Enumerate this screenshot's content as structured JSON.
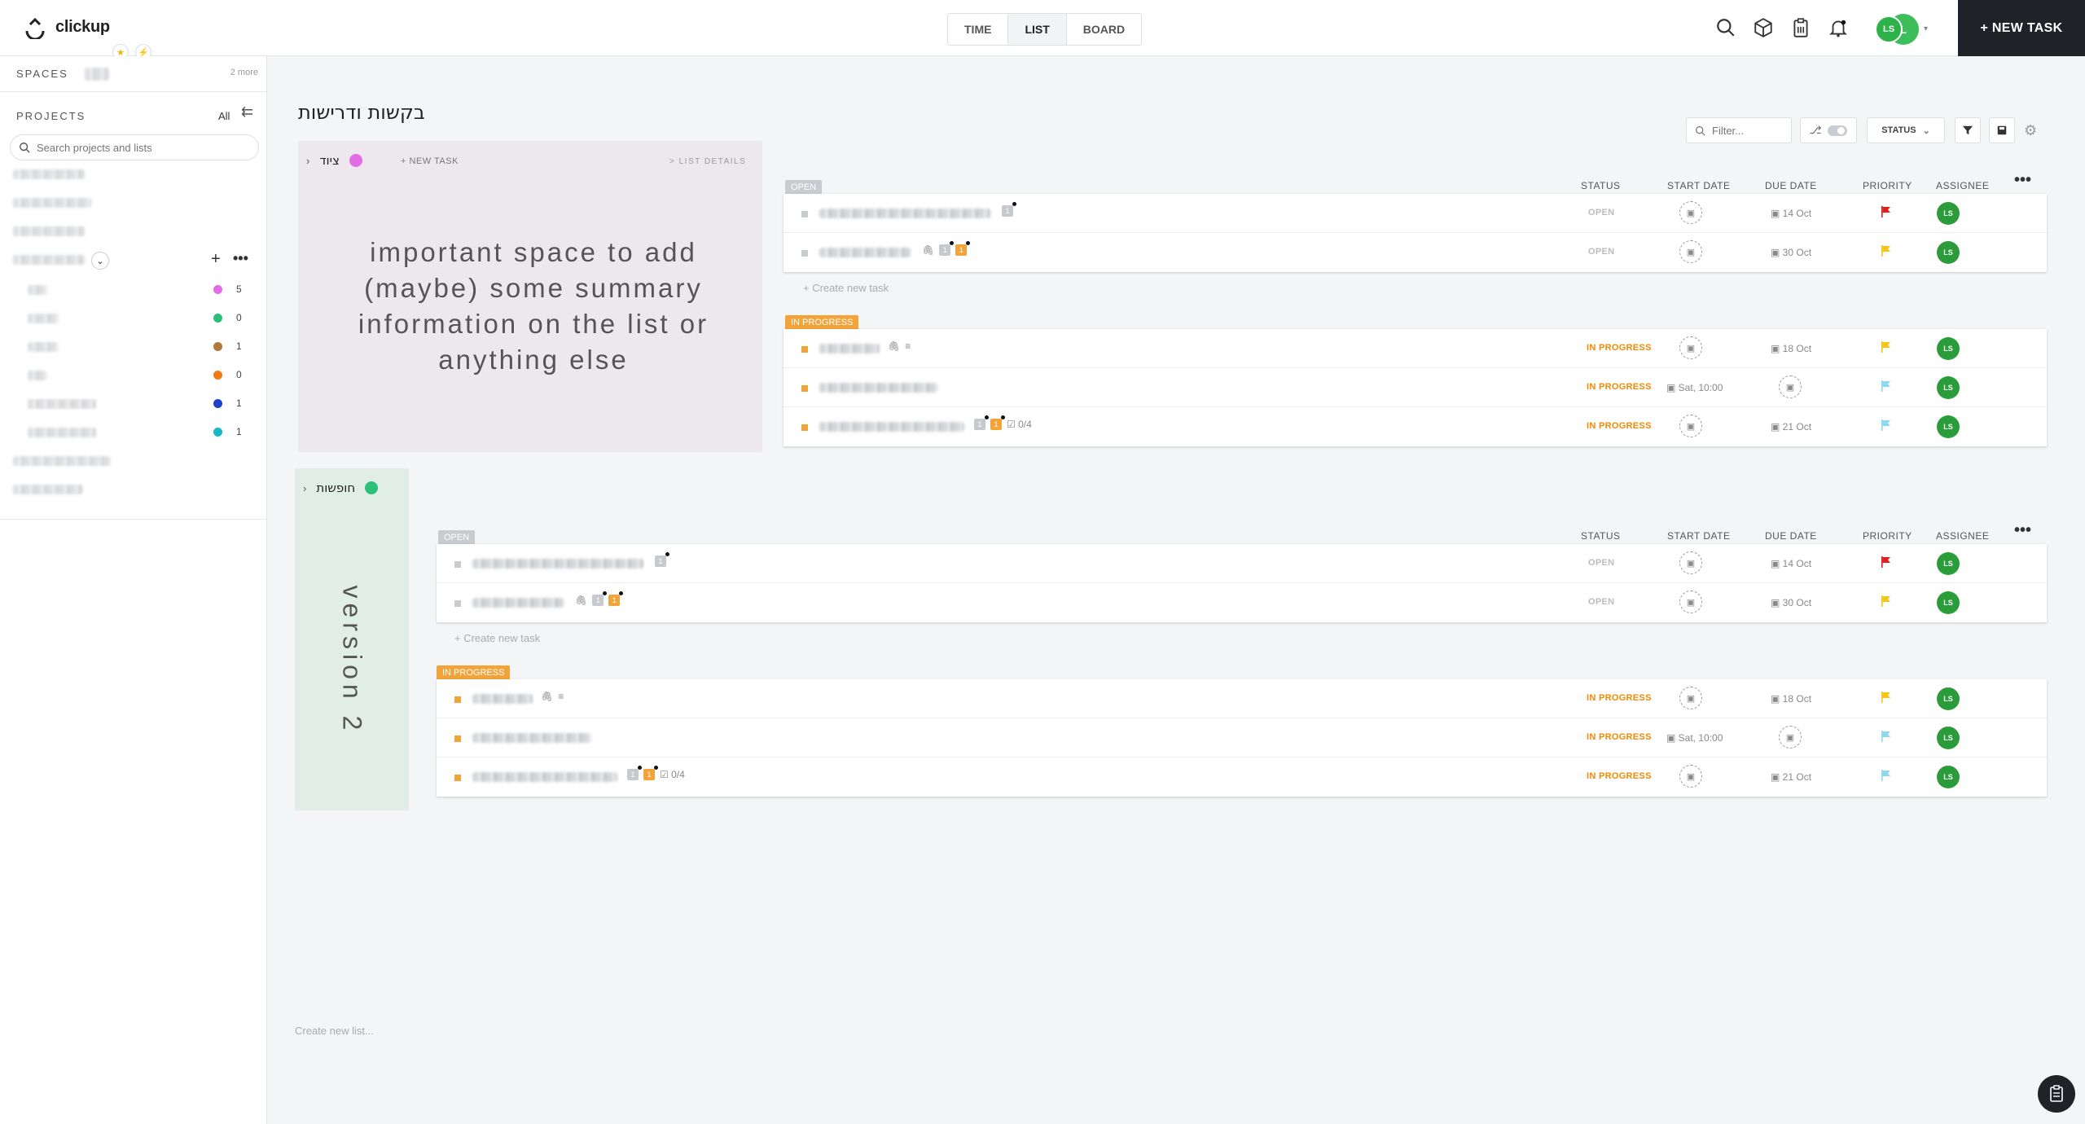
{
  "app": {
    "name": "clickup"
  },
  "header": {
    "views": [
      "TIME",
      "LIST",
      "BOARD"
    ],
    "active_view": "LIST",
    "avatar_initials": "LS",
    "avatar_initials_alt": "L",
    "new_task_label": "+ NEW TASK"
  },
  "sidebar": {
    "spaces_label": "SPACES",
    "spaces_more": "2 more",
    "projects_label": "PROJECTS",
    "projects_filter": "All",
    "search_placeholder": "Search projects and lists",
    "lists": [
      {
        "color": "#e46be6",
        "count": "5"
      },
      {
        "color": "#2bbf7a",
        "count": "0"
      },
      {
        "color": "#b07a3c",
        "count": "1"
      },
      {
        "color": "#f07a14",
        "count": "0"
      },
      {
        "color": "#1f40c8",
        "count": "1"
      },
      {
        "color": "#17b9c4",
        "count": "1"
      }
    ]
  },
  "main": {
    "page_title": "בקשות ודרישות",
    "filter_placeholder": "Filter...",
    "status_button": "STATUS",
    "create_list": "Create new list...",
    "columns": [
      "STATUS",
      "START DATE",
      "DUE DATE",
      "PRIORITY",
      "ASSIGNEE"
    ],
    "create_task": "+  Create new task",
    "lists": [
      {
        "name": "ציוד",
        "color": "#e46be6",
        "new_task": "+ NEW TASK",
        "list_details": "> LIST DETAILS",
        "summary": "important space to add (maybe) some summary information on the list or anything else",
        "groups": [
          {
            "status": "OPEN",
            "color": "#c8cbd0",
            "tasks": [
              {
                "status": "OPEN",
                "due": "14 Oct",
                "priority": "#e02020",
                "assignee": "LS"
              },
              {
                "status": "OPEN",
                "due": "30 Oct",
                "priority": "#f5c518",
                "assignee": "LS"
              }
            ]
          },
          {
            "status": "IN PROGRESS",
            "color": "#f2a33a",
            "tasks": [
              {
                "status": "IN PROGRESS",
                "due": "18 Oct",
                "priority": "#f5c518",
                "assignee": "LS"
              },
              {
                "status": "IN PROGRESS",
                "start": "Sat, 10:00",
                "priority": "#8fd8ef",
                "assignee": "LS"
              },
              {
                "status": "IN PROGRESS",
                "due": "21 Oct",
                "priority": "#8fd8ef",
                "assignee": "LS",
                "checklist": "0/4"
              }
            ]
          }
        ]
      },
      {
        "name": "חופשות",
        "color": "#2bbf7a",
        "summary": "version 2",
        "groups": [
          {
            "status": "OPEN",
            "tasks": [
              {
                "status": "OPEN",
                "due": "14 Oct",
                "priority": "#e02020",
                "assignee": "LS"
              },
              {
                "status": "OPEN",
                "due": "30 Oct",
                "priority": "#f5c518",
                "assignee": "LS"
              }
            ]
          },
          {
            "status": "IN PROGRESS",
            "tasks": [
              {
                "status": "IN PROGRESS",
                "due": "18 Oct",
                "priority": "#f5c518",
                "assignee": "LS"
              },
              {
                "status": "IN PROGRESS",
                "start": "Sat, 10:00",
                "priority": "#8fd8ef",
                "assignee": "LS"
              },
              {
                "status": "IN PROGRESS",
                "due": "21 Oct",
                "priority": "#8fd8ef",
                "assignee": "LS",
                "checklist": "0/4"
              }
            ]
          }
        ]
      }
    ]
  }
}
